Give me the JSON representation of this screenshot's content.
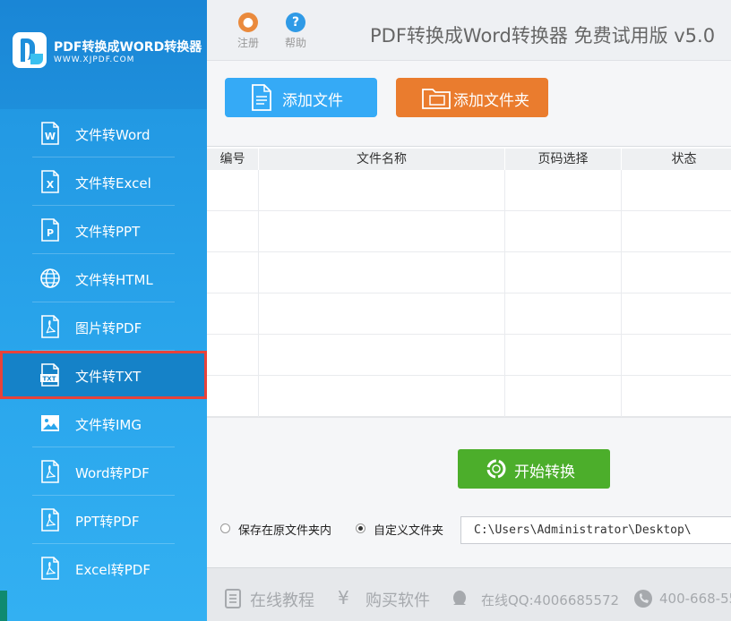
{
  "app": {
    "logo_title": "PDF转换成WORD转换器",
    "logo_url": "WWW.XJPDF.COM",
    "title": "PDF转换成Word转换器 免费试用版 v5.0"
  },
  "header": {
    "register_label": "注册",
    "help_label": "帮助",
    "register_glyph": "●",
    "help_glyph": "?"
  },
  "sidebar": {
    "items": [
      {
        "label": "文件转Word",
        "icon": "word-file-icon",
        "badge": "W"
      },
      {
        "label": "文件转Excel",
        "icon": "excel-file-icon",
        "badge": "X"
      },
      {
        "label": "文件转PPT",
        "icon": "ppt-file-icon",
        "badge": "P"
      },
      {
        "label": "文件转HTML",
        "icon": "globe-icon",
        "badge": ""
      },
      {
        "label": "图片转PDF",
        "icon": "pdf-file-icon",
        "badge": ""
      },
      {
        "label": "文件转TXT",
        "icon": "txt-file-icon",
        "badge": "TXT",
        "active": true
      },
      {
        "label": "文件转IMG",
        "icon": "image-icon",
        "badge": ""
      },
      {
        "label": "Word转PDF",
        "icon": "pdf-file-icon",
        "badge": ""
      },
      {
        "label": "PPT转PDF",
        "icon": "pdf-file-icon",
        "badge": ""
      },
      {
        "label": "Excel转PDF",
        "icon": "pdf-file-icon",
        "badge": ""
      }
    ]
  },
  "toolbar": {
    "add_file": "添加文件",
    "add_folder": "添加文件夹"
  },
  "table": {
    "columns": [
      "编号",
      "文件名称",
      "页码选择",
      "状态"
    ],
    "rows": []
  },
  "actions": {
    "start": "开始转换"
  },
  "save": {
    "option_original": "保存在原文件夹内",
    "option_custom": "自定义文件夹",
    "selected": "自定义文件夹",
    "path": "C:\\Users\\Administrator\\Desktop\\"
  },
  "footer": {
    "tutorial": "在线教程",
    "buy": "购买软件",
    "qq": "在线QQ:4006685572",
    "phone": "400-668-55"
  },
  "colors": {
    "sidebar": "#2aa6ec",
    "accent_blue": "#35aaf6",
    "accent_orange": "#ea7c2e",
    "start_green": "#4cae2b",
    "active_outline": "#e8423a"
  }
}
